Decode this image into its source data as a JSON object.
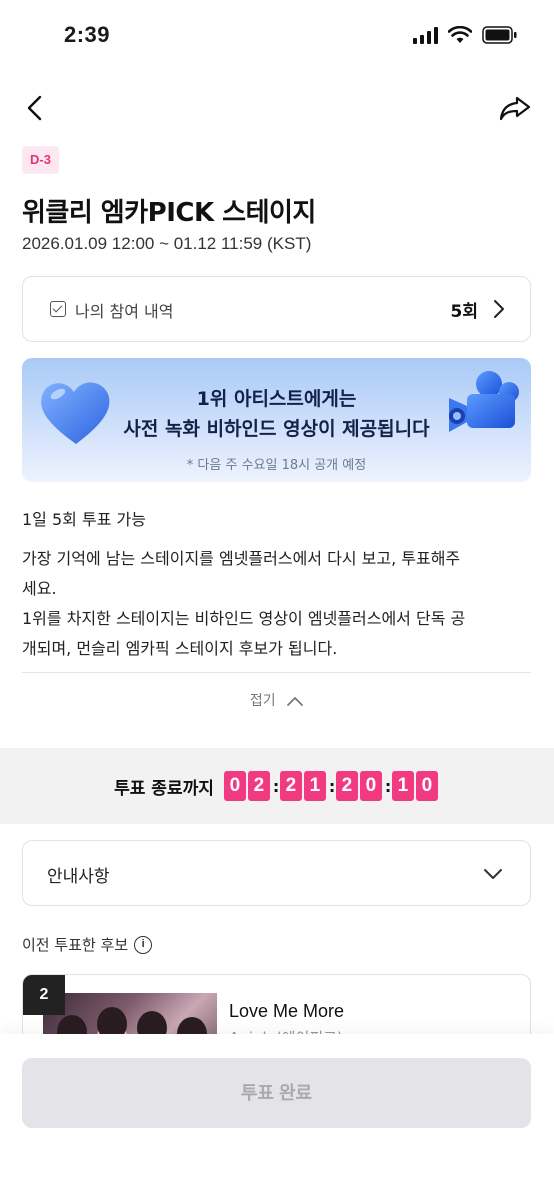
{
  "status_bar": {
    "time": "2:39"
  },
  "header": {
    "dday_badge": "D-3",
    "title": "위클리 엠카PICK 스테이지",
    "period": "2026.01.09 12:00 ~ 01.12 11:59 (KST)"
  },
  "participation": {
    "label": "나의 참여 내역",
    "count": "5회"
  },
  "banner": {
    "line1": "1위 아티스트에게는",
    "line2": "사전 녹화 비하인드 영상이 제공됩니다",
    "note": "* 다음 주 수요일 18시 공개 예정"
  },
  "info": {
    "votes_per_day": "1일 5회 투표 가능",
    "description_lines": [
      "가장 기억에 남는 스테이지를 엠넷플러스에서 다시 보고, 투표해주",
      "세요.",
      "1위를 차지한 스테이지는 비하인드 영상이 엠넷플러스에서 단독 공",
      "개되며, 먼슬리 엠카픽 스테이지 후보가 됩니다."
    ],
    "collapse_label": "접기"
  },
  "countdown": {
    "label": "투표 종료까지",
    "digits": [
      "0",
      "2",
      "2",
      "1",
      "2",
      "0",
      "1",
      "0"
    ]
  },
  "notice": {
    "label": "안내사항"
  },
  "previous": {
    "label": "이전 투표한 후보"
  },
  "candidate": {
    "rank": "2",
    "title": "Love Me More",
    "artist": "Apink (에이핑크)"
  },
  "vote_button": {
    "label": "투표 완료"
  },
  "colors": {
    "accent": "#f23a83",
    "badge_bg": "#fde8f1",
    "button_disabled": "#e4e4e8"
  }
}
